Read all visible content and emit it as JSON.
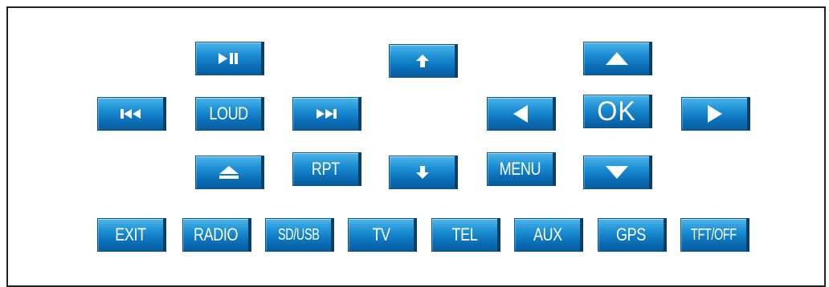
{
  "colors": {
    "button_top": "#4fb5ea",
    "button_mid": "#1c8fd4",
    "button_bottom": "#085c9c",
    "button_edge": "#0a3f68",
    "frame_border": "#222222",
    "background": "#ffffff"
  },
  "buttons": {
    "play_pause_icon": "play-pause-icon",
    "up_small_icon": "arrow-up-small-icon",
    "up_icon": "triangle-up-icon",
    "prev_icon": "skip-previous-icon",
    "loud": "LOUD",
    "next_icon": "skip-next-icon",
    "left_icon": "triangle-left-icon",
    "ok": "OK",
    "right_icon": "triangle-right-icon",
    "eject_icon": "eject-icon",
    "rpt": "RPT",
    "down_small_icon": "arrow-down-small-icon",
    "menu": "MENU",
    "down_icon": "triangle-down-icon",
    "exit": "EXIT",
    "radio": "RADIO",
    "sd_usb": "SD/USB",
    "tv": "TV",
    "tel": "TEL",
    "aux": "AUX",
    "gps": "GPS",
    "tft_off": "TFT/OFF"
  }
}
